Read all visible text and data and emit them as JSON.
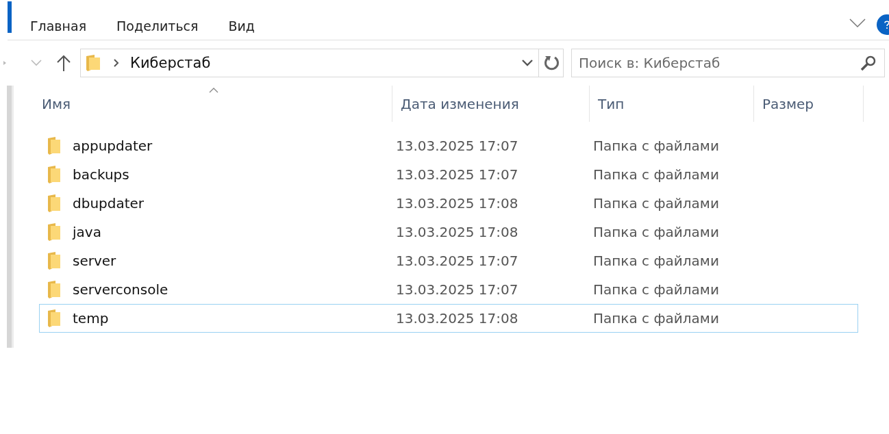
{
  "ribbon": {
    "tabs": [
      {
        "label": "Главная"
      },
      {
        "label": "Поделиться"
      },
      {
        "label": "Вид"
      }
    ]
  },
  "address_bar": {
    "path": [
      "Киберстаб"
    ]
  },
  "search": {
    "placeholder": "Поиск в: Киберстаб"
  },
  "table": {
    "columns": [
      {
        "label": "Имя",
        "sorted": true
      },
      {
        "label": "Дата изменения",
        "sorted": false
      },
      {
        "label": "Тип",
        "sorted": false
      },
      {
        "label": "Размер",
        "sorted": false
      }
    ],
    "rows": [
      {
        "name": "appupdater",
        "date": "13.03.2025 17:07",
        "type": "Папка с файлами",
        "focused": false
      },
      {
        "name": "backups",
        "date": "13.03.2025 17:07",
        "type": "Папка с файлами",
        "focused": false
      },
      {
        "name": "dbupdater",
        "date": "13.03.2025 17:08",
        "type": "Папка с файлами",
        "focused": false
      },
      {
        "name": "java",
        "date": "13.03.2025 17:08",
        "type": "Папка с файлами",
        "focused": false
      },
      {
        "name": "server",
        "date": "13.03.2025 17:07",
        "type": "Папка с файлами",
        "focused": false
      },
      {
        "name": "serverconsole",
        "date": "13.03.2025 17:07",
        "type": "Папка с файлами",
        "focused": false
      },
      {
        "name": "temp",
        "date": "13.03.2025 17:08",
        "type": "Папка с файлами",
        "focused": true
      }
    ]
  }
}
